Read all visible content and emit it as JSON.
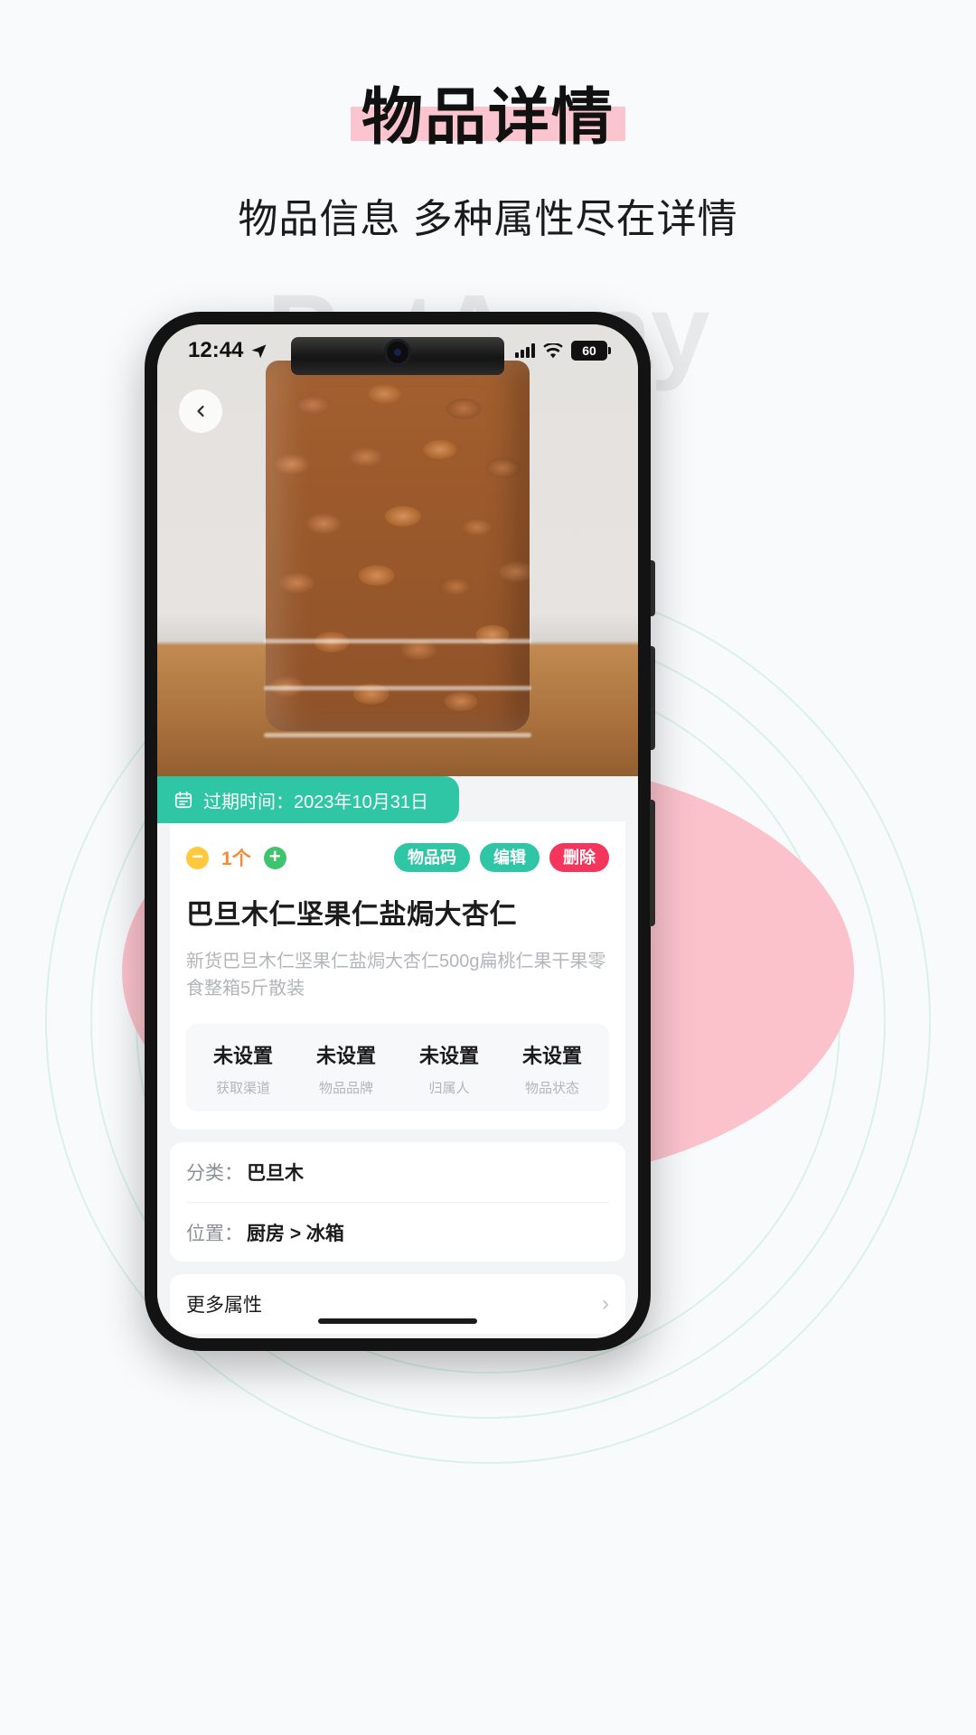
{
  "header": {
    "title": "物品详情",
    "subtitle": "物品信息 多种属性尽在详情",
    "highlight_color": "#fac5ce"
  },
  "background": {
    "watermark": "PutAway",
    "blob_color": "#fbc2cc",
    "ring_color": "#d9f2e8"
  },
  "phone": {
    "status_bar": {
      "time": "12:44",
      "location_icon": "navigation-arrow-icon",
      "signal_icon": "signal-bars-icon",
      "wifi_icon": "wifi-icon",
      "battery_level": "60"
    },
    "hero": {
      "back_icon": "chevron-left-icon",
      "photo_alt": "almonds-in-jar-photo"
    },
    "expiry": {
      "icon": "calendar-icon",
      "text": "过期时间：2023年10月31日",
      "color": "#2ec6a4"
    },
    "quantity": {
      "minus_icon": "minus-circle-icon",
      "value": "1个",
      "plus_icon": "plus-circle-icon",
      "minus_color": "#ffc83d",
      "plus_color": "#3ec46d",
      "value_color": "#f98a34"
    },
    "actions": [
      {
        "label": "物品码",
        "color": "#2ec6a4",
        "name": "item-code-button"
      },
      {
        "label": "编辑",
        "color": "#2ec6a4",
        "name": "edit-button"
      },
      {
        "label": "删除",
        "color": "#f5365c",
        "name": "delete-button"
      }
    ],
    "item": {
      "title": "巴旦木仁坚果仁盐焗大杏仁",
      "description": "新货巴旦木仁坚果仁盐焗大杏仁500g扁桃仁果干果零食整箱5斤散装"
    },
    "attributes": [
      {
        "value": "未设置",
        "label": "获取渠道"
      },
      {
        "value": "未设置",
        "label": "物品品牌"
      },
      {
        "value": "未设置",
        "label": "归属人"
      },
      {
        "value": "未设置",
        "label": "物品状态"
      }
    ],
    "meta": [
      {
        "label": "分类：",
        "value": "巴旦木"
      },
      {
        "label": "位置：",
        "value": "厨房 > 冰箱"
      }
    ],
    "more": {
      "label": "更多属性",
      "chevron": "›"
    }
  }
}
